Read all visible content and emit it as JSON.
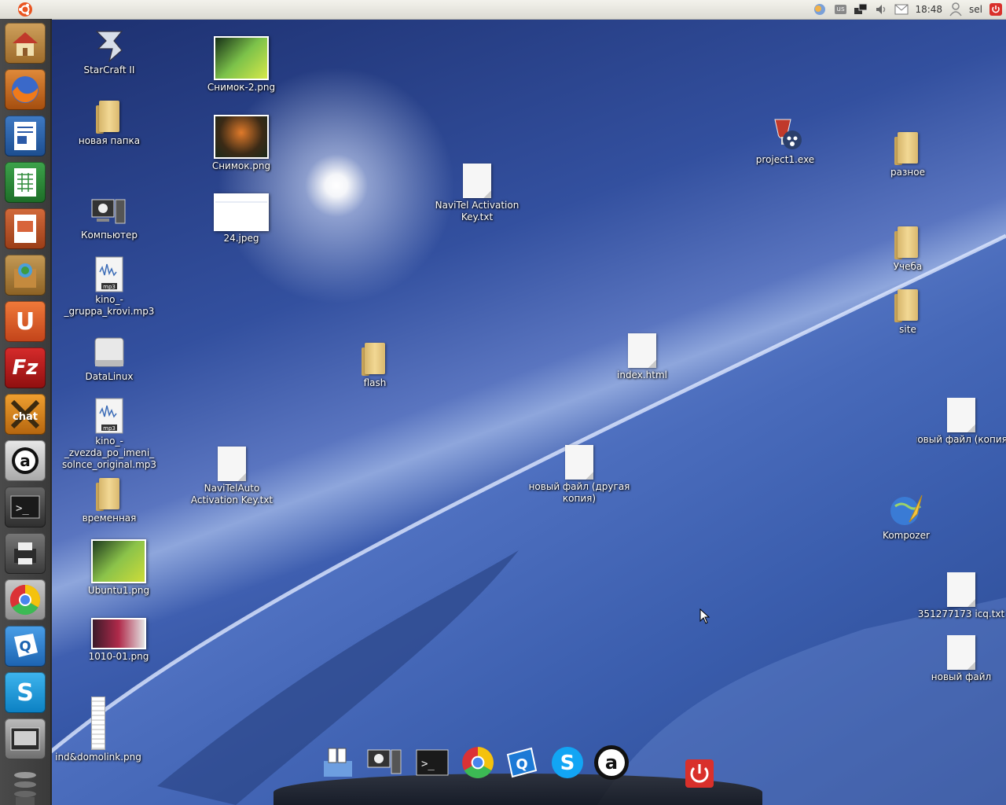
{
  "topbar": {
    "lang_indicator": "us",
    "clock": "18:48",
    "user": "sel"
  },
  "launcher": {
    "items": [
      {
        "name": "home-folder",
        "icon": "home-icon"
      },
      {
        "name": "firefox",
        "icon": "firefox-icon"
      },
      {
        "name": "writer",
        "icon": "libreoffice-writer-icon"
      },
      {
        "name": "calc",
        "icon": "libreoffice-calc-icon"
      },
      {
        "name": "impress",
        "icon": "libreoffice-impress-icon"
      },
      {
        "name": "software-center",
        "icon": "software-center-icon"
      },
      {
        "name": "ubuntu-one",
        "icon": "ubuntu-one-icon",
        "letter": "U"
      },
      {
        "name": "filezilla",
        "icon": "filezilla-icon",
        "letter": "Fz"
      },
      {
        "name": "xchat",
        "icon": "xchat-icon",
        "letter": "chat"
      },
      {
        "name": "amsn",
        "icon": "a-icon",
        "letter": "a"
      },
      {
        "name": "terminal",
        "icon": "terminal-icon",
        "letter": ">_"
      },
      {
        "name": "printer",
        "icon": "printer-icon"
      },
      {
        "name": "chrome",
        "icon": "chrome-icon"
      },
      {
        "name": "qutim",
        "icon": "qip-icon",
        "letter": "Q"
      },
      {
        "name": "skype",
        "icon": "skype-icon",
        "letter": "S"
      },
      {
        "name": "devices",
        "icon": "drive-icon"
      }
    ]
  },
  "desktop": {
    "icons": [
      {
        "label": "StarCraft II"
      },
      {
        "label": "новая папка"
      },
      {
        "label": "Компьютер"
      },
      {
        "label": "kino_-_gruppa_krovi.mp3"
      },
      {
        "label": "DataLinux"
      },
      {
        "label": "kino_-_zvezda_po_imeni_ solnce_original.mp3"
      },
      {
        "label": "временная"
      },
      {
        "label": "Ubuntu1.png"
      },
      {
        "label": "1010-01.png"
      },
      {
        "label": "ind&domolink.png"
      },
      {
        "label": "Снимок-2.png"
      },
      {
        "label": "Снимок.png"
      },
      {
        "label": "24.jpeg"
      },
      {
        "label": "NaviTelAuto Activation Key.txt"
      },
      {
        "label": "NaviTel Activation Key.txt"
      },
      {
        "label": "flash"
      },
      {
        "label": "index.html"
      },
      {
        "label": "новый файл (другая копия)"
      },
      {
        "label": "project1.exe"
      },
      {
        "label": "разное"
      },
      {
        "label": "Учеба"
      },
      {
        "label": "site"
      },
      {
        "label": "новый файл (копия)"
      },
      {
        "label": "Kompozer"
      },
      {
        "label": "351277173 icq.txt"
      },
      {
        "label": "новый файл"
      }
    ]
  },
  "dock": {
    "items": [
      {
        "name": "file-manager",
        "icon": "file-manager-icon"
      },
      {
        "name": "computer",
        "icon": "computer-icon"
      },
      {
        "name": "terminal",
        "icon": "terminal-icon",
        "letter": ">_"
      },
      {
        "name": "chrome",
        "icon": "chrome-icon"
      },
      {
        "name": "qutim",
        "icon": "qip-icon",
        "letter": "Q"
      },
      {
        "name": "skype",
        "icon": "skype-icon",
        "letter": "S"
      },
      {
        "name": "amsn",
        "icon": "a-icon",
        "letter": "a"
      },
      {
        "name": "shutdown",
        "icon": "power-icon"
      }
    ]
  }
}
